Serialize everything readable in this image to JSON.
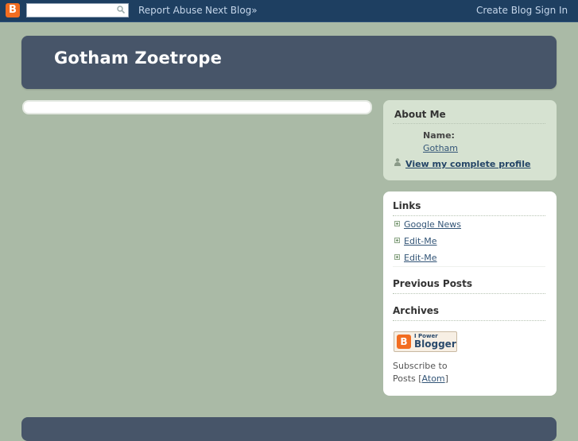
{
  "navbar": {
    "logo_letter": "B",
    "search": {
      "value": "",
      "placeholder": ""
    },
    "report_abuse": "Report Abuse",
    "next_blog": "Next Blog»",
    "create_blog": "Create Blog",
    "sign_in": "Sign In"
  },
  "header": {
    "title": "Gotham Zoetrope"
  },
  "about": {
    "heading": "About Me",
    "name_label": "Name:",
    "name_value": "Gotham",
    "profile_link": "View my complete profile"
  },
  "links": {
    "heading": "Links",
    "items": [
      "Google News",
      "Edit-Me",
      "Edit-Me"
    ]
  },
  "previous_posts": {
    "heading": "Previous Posts"
  },
  "archives": {
    "heading": "Archives"
  },
  "powered_by": {
    "line1": "I Power",
    "line2": "Blogger",
    "logo_letter": "B"
  },
  "subscribe": {
    "text_prefix": "Subscribe to",
    "text_posts": "Posts [",
    "atom": "Atom",
    "suffix": "]"
  },
  "colors": {
    "navbar": "#1e3f61",
    "background": "#aabaa6",
    "header": "#475569",
    "about_bg": "#d6e2d1",
    "brand": "#f26d21"
  }
}
